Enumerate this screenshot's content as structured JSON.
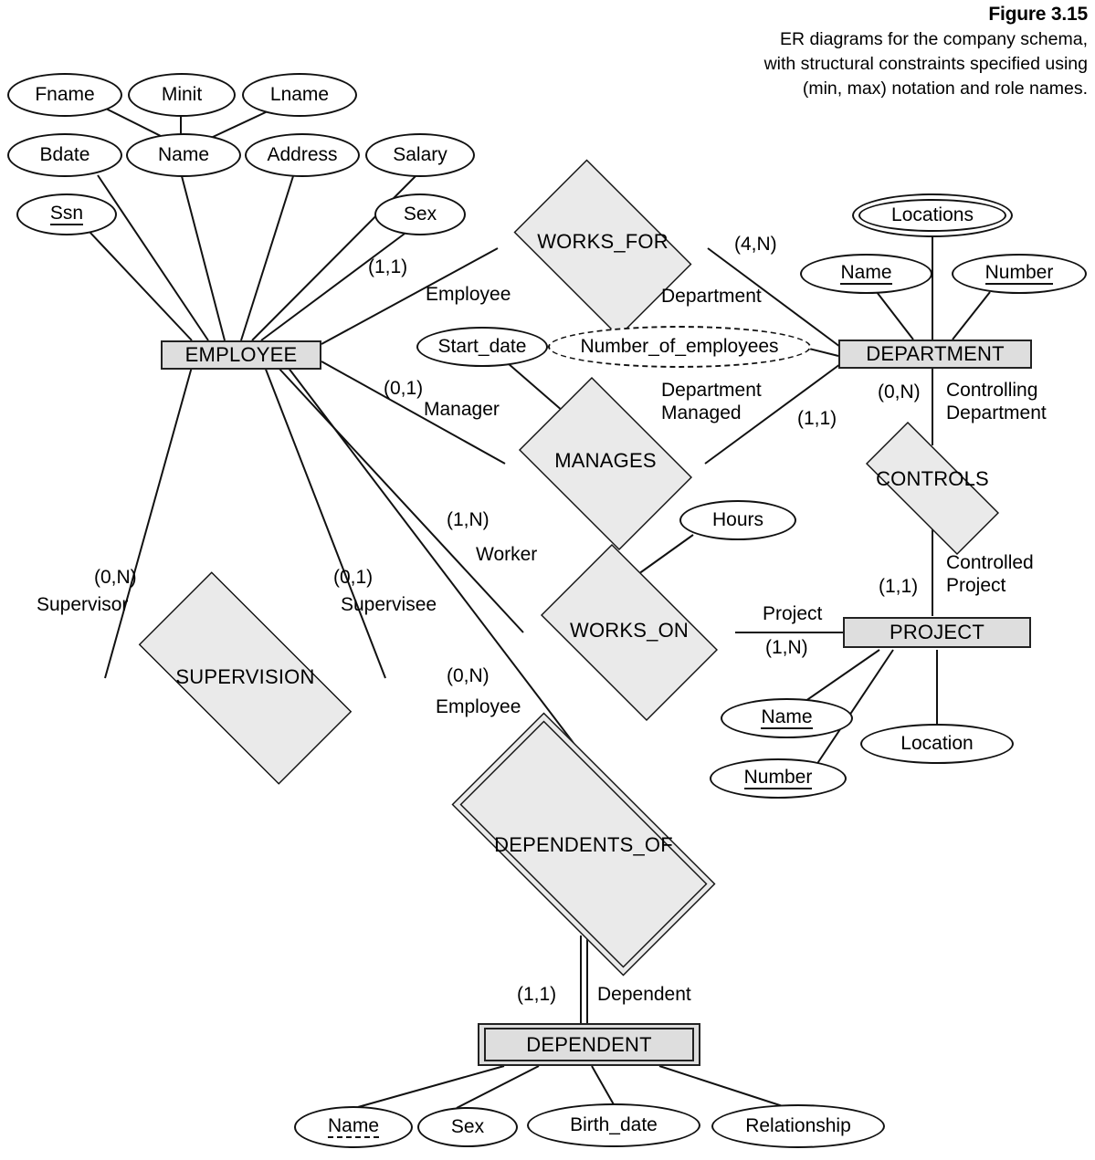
{
  "figure": {
    "title": "Figure 3.15",
    "description": "ER diagrams for the company schema, with structural constraints specified using (min, max) notation and role names."
  },
  "entities": {
    "employee": {
      "name": "EMPLOYEE"
    },
    "department": {
      "name": "DEPARTMENT"
    },
    "project": {
      "name": "PROJECT"
    },
    "dependent": {
      "name": "DEPENDENT"
    }
  },
  "relationships": {
    "works_for": {
      "name": "WORKS_FOR"
    },
    "manages": {
      "name": "MANAGES"
    },
    "supervision": {
      "name": "SUPERVISION"
    },
    "works_on": {
      "name": "WORKS_ON"
    },
    "controls": {
      "name": "CONTROLS"
    },
    "dependents_of": {
      "name": "DEPENDENTS_OF"
    }
  },
  "attributes": {
    "employee": [
      {
        "label": "Fname",
        "kind": "simple"
      },
      {
        "label": "Minit",
        "kind": "simple"
      },
      {
        "label": "Lname",
        "kind": "simple"
      },
      {
        "label": "Bdate",
        "kind": "simple"
      },
      {
        "label": "Name",
        "kind": "composite"
      },
      {
        "label": "Address",
        "kind": "simple"
      },
      {
        "label": "Salary",
        "kind": "simple"
      },
      {
        "label": "Ssn",
        "kind": "key"
      },
      {
        "label": "Sex",
        "kind": "simple"
      }
    ],
    "department": [
      {
        "label": "Locations",
        "kind": "multivalued"
      },
      {
        "label": "Name",
        "kind": "key"
      },
      {
        "label": "Number",
        "kind": "key"
      },
      {
        "label": "Number_of_employees",
        "kind": "derived"
      }
    ],
    "project": [
      {
        "label": "Name",
        "kind": "key"
      },
      {
        "label": "Number",
        "kind": "key"
      },
      {
        "label": "Location",
        "kind": "simple"
      }
    ],
    "dependent": [
      {
        "label": "Name",
        "kind": "partial-key"
      },
      {
        "label": "Sex",
        "kind": "simple"
      },
      {
        "label": "Birth_date",
        "kind": "simple"
      },
      {
        "label": "Relationship",
        "kind": "simple"
      }
    ],
    "relationship_attributes": [
      {
        "label": "Start_date",
        "kind": "simple",
        "owner": "MANAGES"
      },
      {
        "label": "Hours",
        "kind": "simple",
        "owner": "WORKS_ON"
      }
    ]
  },
  "constraints": {
    "works_for_employee": "(1,1)",
    "works_for_department": "(4,N)",
    "manages_manager": "(0,1)",
    "manages_department": "(1,1)",
    "supervision_supervisor": "(0,N)",
    "supervision_supervisee": "(0,1)",
    "works_on_worker": "(1,N)",
    "works_on_project": "(1,N)",
    "controls_department": "(0,N)",
    "controls_project": "(1,1)",
    "dependents_of_employee": "(0,N)",
    "dependents_of_dependent": "(1,1)"
  },
  "roles": {
    "works_for_employee": "Employee",
    "works_for_department": "Department",
    "manages_manager": "Manager",
    "manages_department": "Department\nManaged",
    "supervision_supervisor": "Supervisor",
    "supervision_supervisee": "Supervisee",
    "works_on_worker": "Worker",
    "works_on_project": "Project",
    "controls_department": "Controlling\nDepartment",
    "controls_project": "Controlled\nProject",
    "dependents_of_employee": "Employee",
    "dependents_of_dependent": "Dependent"
  },
  "colors": {
    "entity_fill": "#dedede",
    "relationship_fill": "#eaeaea",
    "stroke": "#111111",
    "background": "#ffffff"
  }
}
